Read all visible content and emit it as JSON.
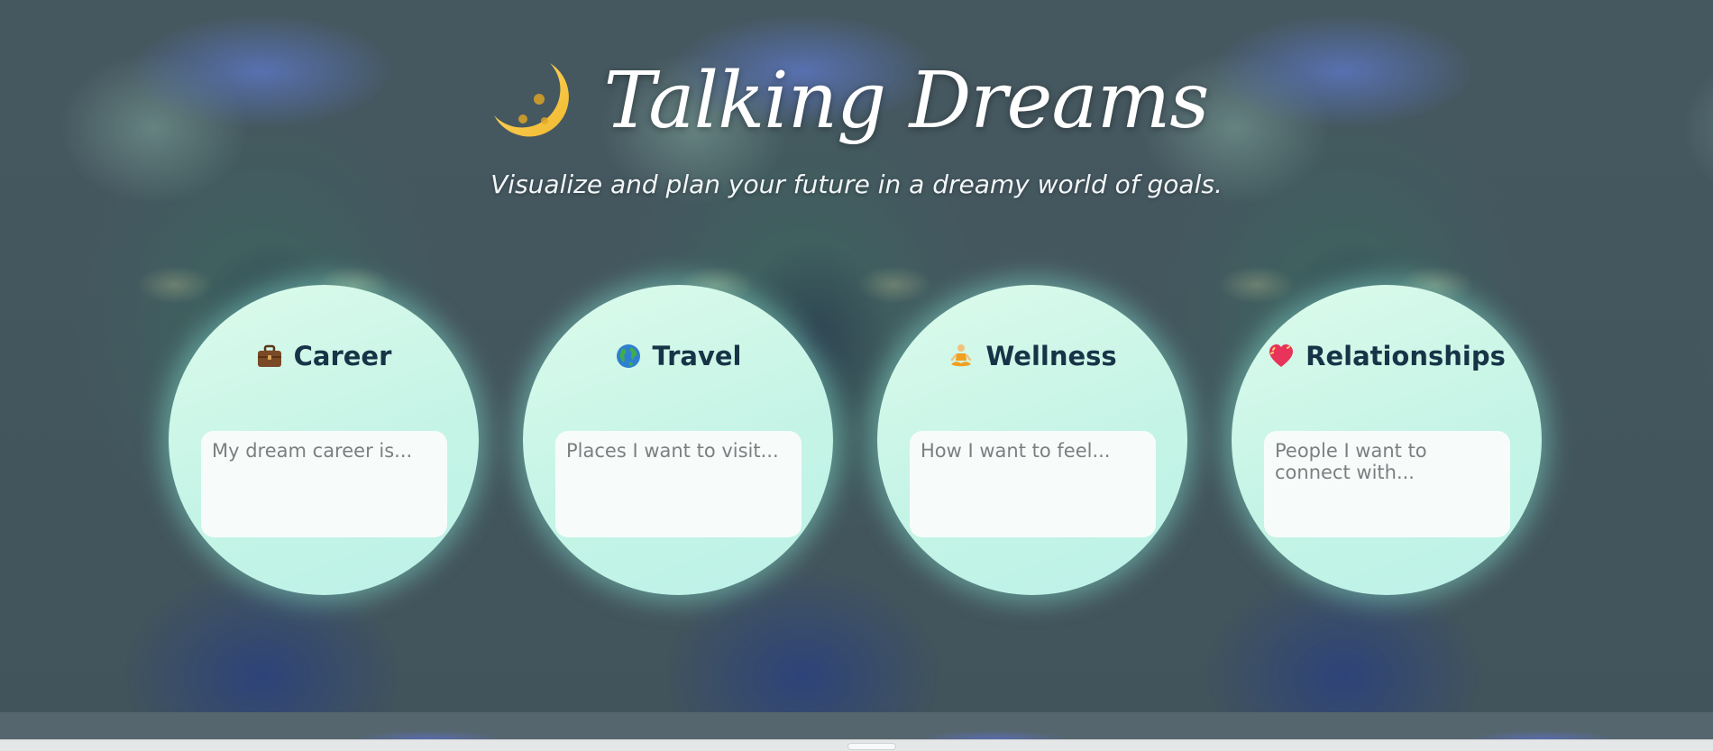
{
  "header": {
    "title": "Talking Dreams",
    "title_icon": "crescent-moon-icon",
    "subtitle": "Visualize and plan your future in a dreamy world of goals."
  },
  "cards": [
    {
      "label": "Career",
      "icon": "briefcase-icon",
      "placeholder": "My dream career is..."
    },
    {
      "label": "Travel",
      "icon": "globe-icon",
      "placeholder": "Places I want to visit..."
    },
    {
      "label": "Wellness",
      "icon": "meditation-icon",
      "placeholder": "How I want to feel..."
    },
    {
      "label": "Relationships",
      "icon": "heart-icon",
      "placeholder": "People I want to connect with..."
    }
  ],
  "colors": {
    "card_fill": "#c9f6e8",
    "heading_text": "#173447",
    "title_text": "#ffffff",
    "moon": "#f5c84a"
  }
}
